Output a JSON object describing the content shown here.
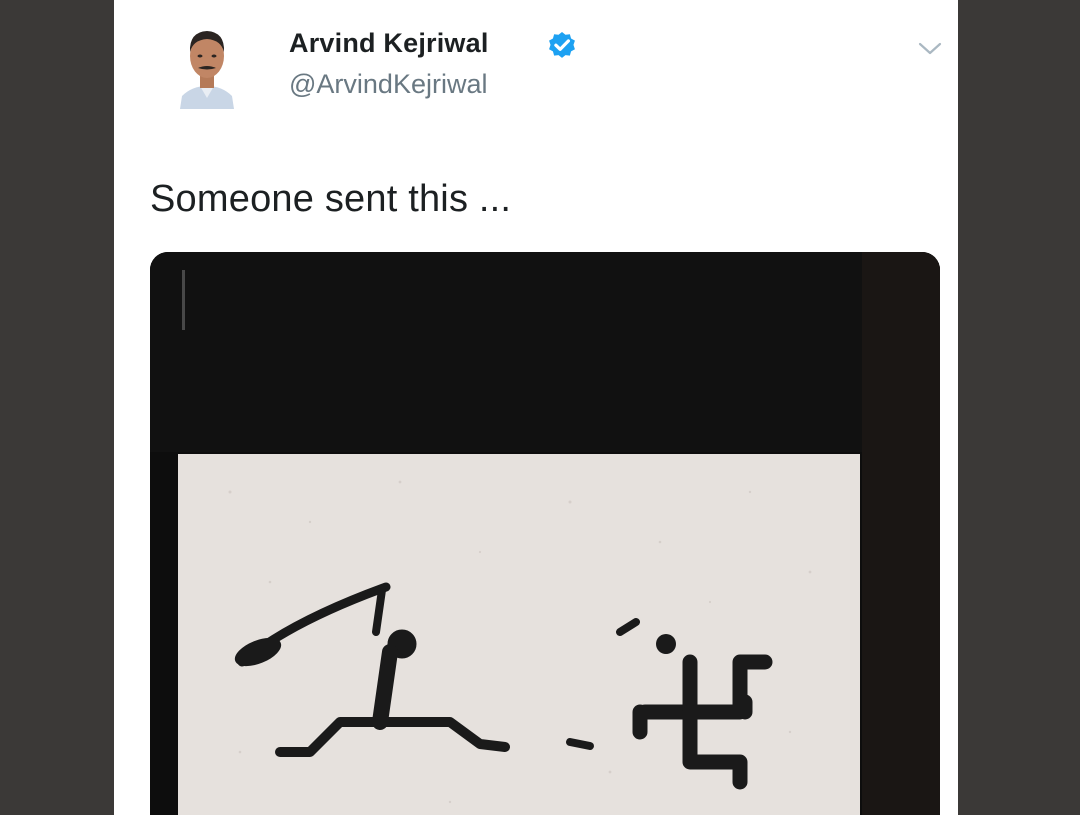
{
  "app": {
    "background_color": "#3b3937",
    "card_color": "#ffffff"
  },
  "tweet": {
    "author": {
      "name": "Arvind Kejriwal",
      "handle": "@ArvindKejriwal",
      "verified": true,
      "verified_icon": "verified-badge-icon",
      "verified_color": "#1da1f2"
    },
    "menu_icon": "chevron-down-icon",
    "text": "Someone sent this ...",
    "media": {
      "kind": "photo",
      "subject": "stencil graffiti on a white wall"
    }
  }
}
